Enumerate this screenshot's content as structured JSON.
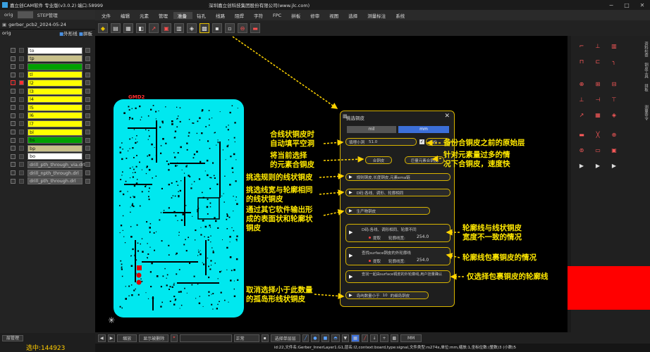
{
  "window": {
    "title": "嘉立创CAM软件 专业版(v3.0.2) 端口:58999",
    "company": "深圳嘉立创科技集团股份有限公司(www.jlc.com)"
  },
  "menu": [
    "文件",
    "编辑",
    "元素",
    "管理",
    "准备",
    "钻孔",
    "线路",
    "阻焊",
    "字符",
    "FPC",
    "拼板",
    "修审",
    "视图",
    "选择",
    "测量标注",
    "系统"
  ],
  "active_menu": "准备",
  "left_panel": {
    "tabs": [
      "orig",
      "STEP管理"
    ],
    "job": "gerber_pcb2_2024-05-24",
    "step": "orig",
    "opt_outline": "外形线",
    "opt_panel": "拼板",
    "layers": [
      {
        "name": "to",
        "color": "#ffffff"
      },
      {
        "name": "tp",
        "color": "#c8c08a"
      },
      {
        "name": "",
        "color": "#00a000"
      },
      {
        "name": "tl",
        "color": "#ffff00"
      },
      {
        "name": "l2",
        "color": "#ffff00"
      },
      {
        "name": "l3",
        "color": "#ffff00"
      },
      {
        "name": "l4",
        "color": "#ffff00"
      },
      {
        "name": "l5",
        "color": "#ffff00"
      },
      {
        "name": "l6",
        "color": "#ffff00"
      },
      {
        "name": "l7",
        "color": "#ffff00"
      },
      {
        "name": "bl",
        "color": "#ffff00"
      },
      {
        "name": "bs",
        "color": "#00a000"
      },
      {
        "name": "bp",
        "color": "#c8c08a"
      },
      {
        "name": "bo",
        "color": "#ffffff"
      },
      {
        "name": "drill_pth_through_via.drl",
        "color": "#555555"
      },
      {
        "name": "drill_npth_through.drl",
        "color": "#555555"
      },
      {
        "name": "drill_pth_through.drl",
        "color": "#555555"
      }
    ],
    "bottom_btn": "层管理",
    "selected": "选中:144923"
  },
  "canvas": {
    "label": "GMD2"
  },
  "dialog": {
    "title": "挑选铜皮",
    "tab_mil": "mil",
    "tab_mm": "mm",
    "fill_label": "填埋小洞",
    "fill_value": "51.0",
    "backup_label": "备份",
    "merge_btn": "合铜皮",
    "merge_many_btn": "巨量元素合铜皮",
    "pick_rule": "规则铜皮,长度铜皮,元素ema链",
    "pick_same": "D码:各线、调形、轮廓相同",
    "produce": "生产物铜皮",
    "d_diff": "D码:各线、调形相同、轮廓不同",
    "extract1": "提取",
    "contour1": "轮廓线宽:",
    "contour1_val": "254.0",
    "surface": "查找surface铜皮的外轮廓线",
    "extract2": "提取",
    "contour2": "轮廓线宽:",
    "contour2_val": "254.0",
    "select_outline": "查找一起由surface铜皮的外轮廓线,用户挂量确认",
    "island_label": "岛屿数量小于",
    "island_value": "10",
    "island_unit": "的细岛铜皮"
  },
  "annotations": {
    "a1": "合线状铜皮时\n自动填平空洞",
    "a2": "将当前选择\n的元素合铜皮",
    "a3": "挑选规则的线状铜皮",
    "a4": "挑选线宽与轮廓相同\n的线状铜皮",
    "a5": "通过其它软件输出形\n成的表面状和轮廓状\n铜皮",
    "a6": "取消选择小于此数量\n的孤岛形线状铜皮",
    "b1": "备份合铜皮之前的原始层",
    "b2": "针对元素量过多的情\n况下合铜皮，速度快",
    "b3": "轮廓线与线状铜皮\n宽度不一致的情况",
    "b4": "轮廓线包裹铜皮的情况",
    "b5": "仅选择包裹铜皮的轮廓线"
  },
  "right_panel": {
    "labels": [
      "资料检查",
      "铜皮工具",
      "拼板",
      "测量命令"
    ]
  },
  "statusbar": {
    "zoom": "缩放",
    "btn1": "显示被删除",
    "mode": "正常",
    "btn2": "选择单层层",
    "unit": "MM"
  },
  "infobar": "id:22,文件名:Gerber_InnerLayer1.G1,层名:l2,context:board,type:signal,文件类型:rs274x,单位:mm,缩放:1,坐标位数:(整数)3 (小数)5"
}
